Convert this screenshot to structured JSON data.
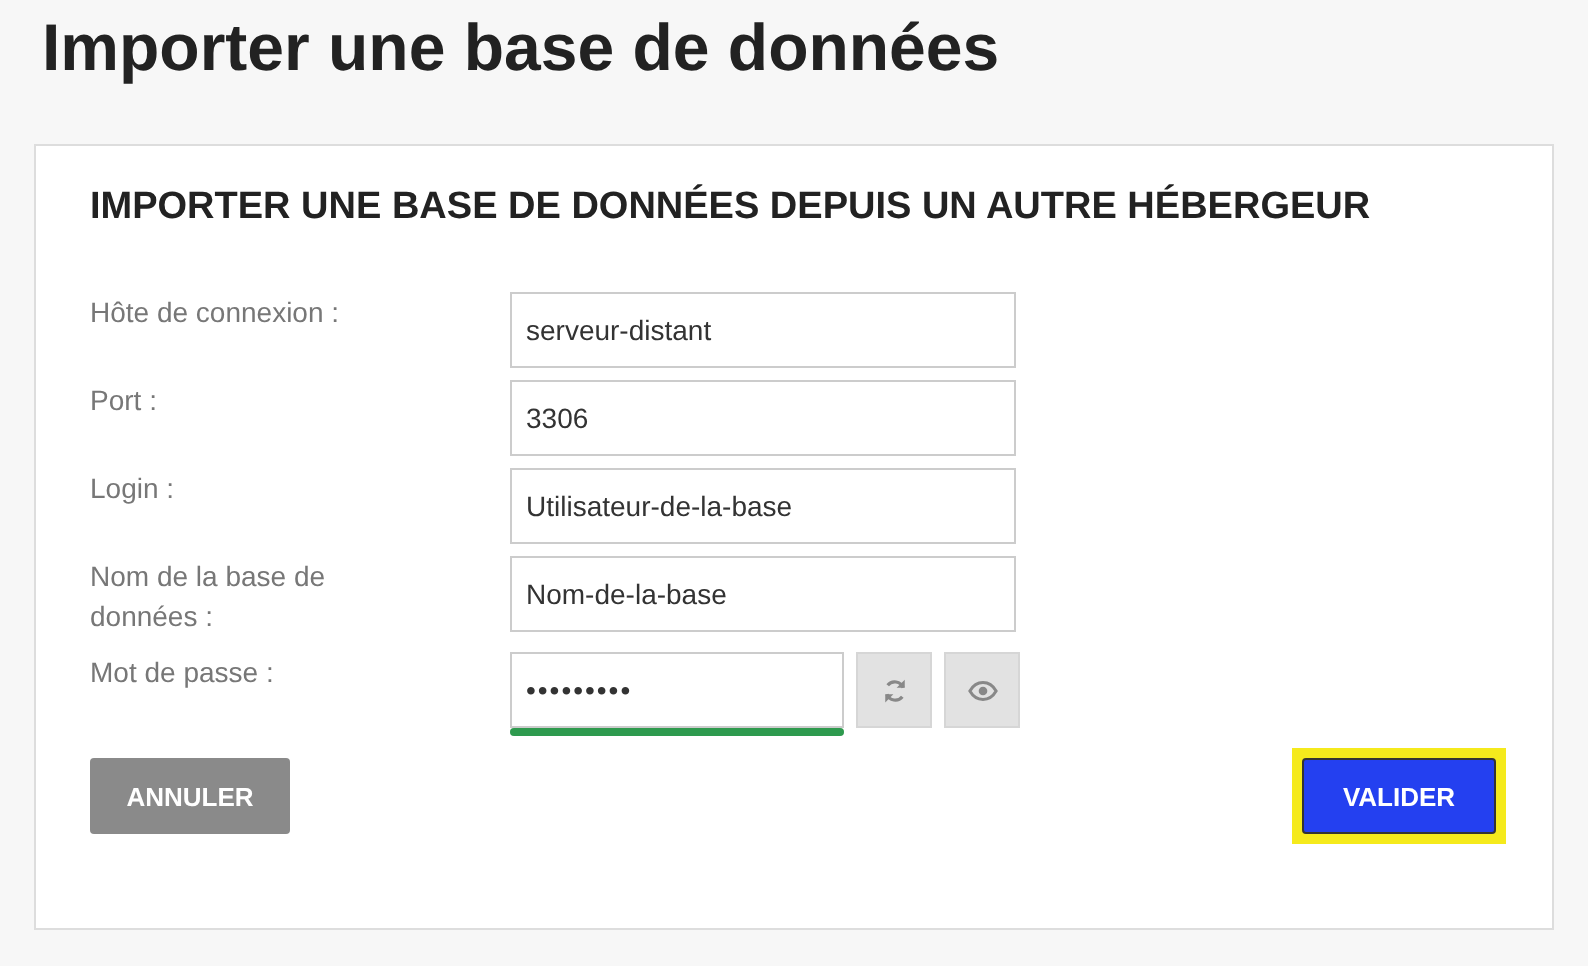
{
  "page_title": "Importer une base de données",
  "form": {
    "title": "IMPORTER UNE BASE DE DONNÉES DEPUIS UN AUTRE HÉBERGEUR",
    "fields": [
      {
        "kind": "text",
        "label": "Hôte de connexion :",
        "value": "serveur-distant"
      },
      {
        "kind": "text",
        "label": "Port :",
        "value": "3306"
      },
      {
        "kind": "text",
        "label": "Login :",
        "value": "Utilisateur-de-la-base"
      },
      {
        "kind": "text",
        "label": "Nom de la base de données :",
        "value": "Nom-de-la-base"
      },
      {
        "kind": "password",
        "label": "Mot de passe :",
        "value": "•••••••••",
        "level": 1
      }
    ],
    "buttons": [
      {
        "kind": "cancel",
        "label": "ANNULER",
        "highlighted": false
      },
      {
        "kind": "submit",
        "label": "VALIDER",
        "highlighted": true
      }
    ]
  }
}
